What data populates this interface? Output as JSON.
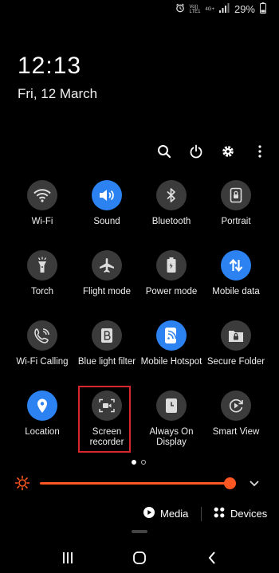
{
  "status_bar": {
    "network_top": "Vo))",
    "network_mid": "LTE1",
    "network_right": "4G+",
    "battery": "29%"
  },
  "lockscreen": {
    "time": "12:13",
    "date": "Fri, 12 March"
  },
  "tiles": [
    {
      "label": "Wi-Fi",
      "icon": "wifi-icon",
      "on": false
    },
    {
      "label": "Sound",
      "icon": "sound-icon",
      "on": true
    },
    {
      "label": "Bluetooth",
      "icon": "bluetooth-icon",
      "on": false
    },
    {
      "label": "Portrait",
      "icon": "portrait-icon",
      "on": false
    },
    {
      "label": "Torch",
      "icon": "torch-icon",
      "on": false
    },
    {
      "label": "Flight mode",
      "icon": "airplane-icon",
      "on": false
    },
    {
      "label": "Power mode",
      "icon": "power-mode-icon",
      "on": false
    },
    {
      "label": "Mobile data",
      "icon": "mobile-data-icon",
      "on": true
    },
    {
      "label": "Wi-Fi Calling",
      "icon": "wifi-calling-icon",
      "on": false
    },
    {
      "label": "Blue light filter",
      "icon": "blue-light-icon",
      "on": false
    },
    {
      "label": "Mobile Hotspot",
      "icon": "hotspot-icon",
      "on": true
    },
    {
      "label": "Secure Folder",
      "icon": "secure-folder-icon",
      "on": false
    },
    {
      "label": "Location",
      "icon": "location-icon",
      "on": true
    },
    {
      "label": "Screen recorder",
      "icon": "screen-recorder-icon",
      "on": false
    },
    {
      "label": "Always On Display",
      "icon": "always-on-display-icon",
      "on": false
    },
    {
      "label": "Smart View",
      "icon": "smart-view-icon",
      "on": false
    }
  ],
  "page_dots": {
    "count": 2,
    "active": 1
  },
  "brightness": {
    "level_fraction": 0.92,
    "accent": "#ff5722"
  },
  "bottom": {
    "media_label": "Media",
    "devices_label": "Devices"
  },
  "colors": {
    "tile_on": "#2b82f0",
    "tile_off": "#3b3b3b",
    "highlight": "#d8262f"
  }
}
